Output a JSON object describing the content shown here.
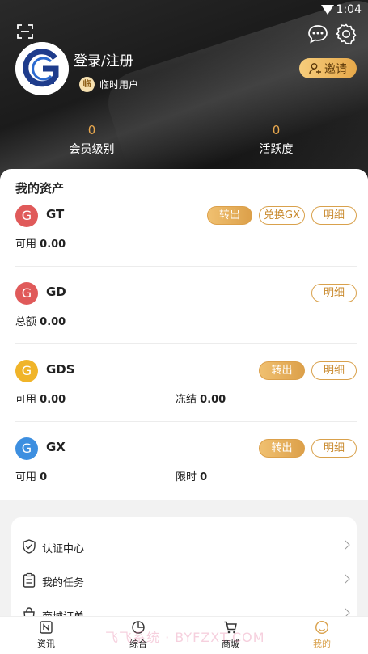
{
  "status_bar": {
    "time": "1:04"
  },
  "profile": {
    "login_label": "登录/注册",
    "badge_icon_text": "临",
    "badge_label": "临时用户",
    "invite_label": "邀请"
  },
  "stats": [
    {
      "value": "0",
      "label": "会员级别"
    },
    {
      "value": "0",
      "label": "活跃度"
    }
  ],
  "assets": {
    "title": "我的资产",
    "items": [
      {
        "coin": "G",
        "name": "GT",
        "color": "#e05a5a",
        "fields": [
          {
            "label": "可用",
            "value": "0.00"
          }
        ],
        "buttons": [
          "转出",
          "兑换GX",
          "明细"
        ]
      },
      {
        "coin": "G",
        "name": "GD",
        "color": "#e05a5a",
        "fields": [
          {
            "label": "总额",
            "value": "0.00"
          }
        ],
        "buttons": [
          "明细"
        ]
      },
      {
        "coin": "G",
        "name": "GDS",
        "color": "#f0b429",
        "fields": [
          {
            "label": "可用",
            "value": "0.00"
          },
          {
            "label": "冻结",
            "value": "0.00"
          }
        ],
        "buttons": [
          "转出",
          "明细"
        ]
      },
      {
        "coin": "G",
        "name": "GX",
        "color": "#3d8fe0",
        "fields": [
          {
            "label": "可用",
            "value": "0"
          },
          {
            "label": "限时",
            "value": "0"
          }
        ],
        "buttons": [
          "转出",
          "明细"
        ]
      }
    ]
  },
  "menu": {
    "items": [
      {
        "label": "认证中心",
        "icon": "shield-check-icon"
      },
      {
        "label": "我的任务",
        "icon": "clipboard-icon"
      },
      {
        "label": "商城订单",
        "icon": "bag-icon"
      }
    ]
  },
  "tabs": [
    {
      "label": "资讯",
      "icon": "news-icon",
      "active": false
    },
    {
      "label": "综合",
      "icon": "pie-chart-icon",
      "active": false
    },
    {
      "label": "商城",
      "icon": "cart-icon",
      "active": false
    },
    {
      "label": "我的",
      "icon": "user-face-icon",
      "active": true
    }
  ],
  "watermark": "飞飞系统 · BYFZXT.COM",
  "colors": {
    "accent_gold": "#d9a14c",
    "stat_orange": "#e9a84e"
  }
}
